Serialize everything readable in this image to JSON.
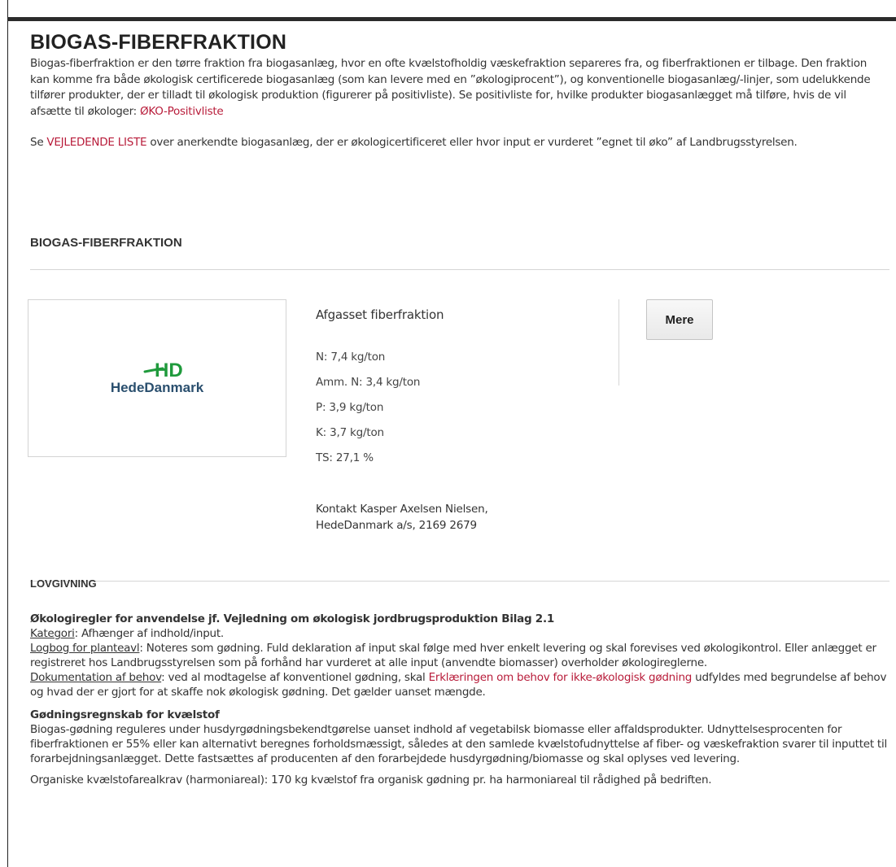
{
  "page": {
    "title": "BIOGAS-FIBERFRAKTION",
    "intro_p1_text": "Biogas-fiberfraktion er den tørre fraktion fra biogasanlæg, hvor en ofte kvælstofholdig væskefraktion separeres fra, og fiberfraktionen er tilbage. Den fraktion kan komme fra både økologisk certificerede biogasanlæg (som kan levere med en ”økologiprocent”), og konventionelle biogasanlæg/-linjer, som udelukkende tilfører produkter, der er tilladt til økologisk produktion (figurerer på positivliste). Se positivliste for, hvilke produkter biogasanlægget må tilføre, hvis de vil afsætte til økologer:",
    "intro_p1_link": "ØKO-Positivliste",
    "intro_p2_before": "Se",
    "intro_p2_link": "VEJLEDENDE LISTE",
    "intro_p2_after": "over anerkendte biogasanlæg, der er økologicertificeret eller hvor input er vurderet ”egnet til øko” af Landbrugsstyrelsen.",
    "section_title": "BIOGAS-FIBERFRAKTION"
  },
  "product": {
    "logo_mark": "HD",
    "logo_text": "HedeDanmark",
    "name": "Afgasset fiberfraktion",
    "nutrients": [
      "N: 7,4 kg/ton",
      "Amm. N: 3,4 kg/ton",
      "P: 3,9 kg/ton",
      "K: 3,7 kg/ton",
      "TS: 27,1 %"
    ],
    "contact_line1": "Kontakt Kasper Axelsen Nielsen,",
    "contact_line2": "HedeDanmark a/s, 2169 2679",
    "more_button": "Mere",
    "colors": {
      "logo_green": "#1f9a3c",
      "logo_blue": "#2a4f6e"
    }
  },
  "law": {
    "heading": "LOVGIVNING",
    "rules_title": "Økologiregler for anvendelse jf. Vejledning om økologisk jordbrugsproduktion Bilag 2.1",
    "category_label": "Kategori",
    "category_text": ": Afhænger af indhold/input.",
    "logbook_label": "Logbog for planteavl",
    "logbook_text": ": Noteres som gødning. Fuld deklaration af input skal følge med hver enkelt levering og skal forevises ved økologikontrol. Eller anlægget er registreret hos Landbrugsstyrelsen som på forhånd har vurderet at alle input (anvendte biomasser) overholder økologireglerne.",
    "doc_label": "Dokumentation af behov",
    "doc_text_before": ": ved al modtagelse af konventionel gødning, skal",
    "doc_link": "Erklæringen om behov for ikke-økologisk gødning",
    "doc_text_after": "udfyldes med begrundelse af behov og hvad der er gjort for at skaffe nok økologisk gødning. Det gælder uanset mængde.",
    "nitrogen_title": "Gødningsregnskab for kvælstof",
    "nitrogen_text": "Biogas-gødning reguleres under husdyrgødningsbekendtgørelse uanset indhold af vegetabilsk biomasse eller affaldsprodukter. Udnyttelsesprocenten for fiberfraktionen er 55% eller kan alternativt beregnes forholdsmæssigt, således at den samlede kvælstofudnyttelse af fiber- og væskefraktion svarer til inputtet til forarbejdningsanlægget. Dette fastsættes af producenten af den forarbejdede husdyrgødning/biomasse og skal oplyses ved levering.",
    "organic_text": "Organiske kvælstofarealkrav (harmoniareal): 170 kg kvælstof fra organisk gødning pr. ha harmoniareal til rådighed på bedriften."
  },
  "colors": {
    "link_red": "#b81c3a",
    "top_bar": "#2b2b2b"
  }
}
